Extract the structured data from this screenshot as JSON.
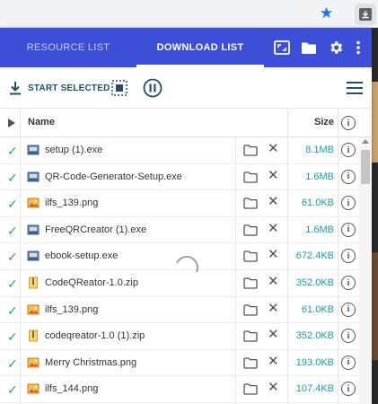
{
  "tabs": {
    "resource_list": "RESOURCE LIST",
    "download_list": "DOWNLOAD LIST"
  },
  "toolbar": {
    "start_selected": "START SELECTED"
  },
  "table": {
    "col_name": "Name",
    "col_size": "Size",
    "info_glyph": "i",
    "rows": [
      {
        "name": "setup (1).exe",
        "size": "8.1MB",
        "icon": "exe-icon"
      },
      {
        "name": "QR-Code-Generator-Setup.exe",
        "size": "1.6MB",
        "icon": "exe-icon"
      },
      {
        "name": "ilfs_139.png",
        "size": "61.0KB",
        "icon": "image-icon"
      },
      {
        "name": "FreeQRCreator (1).exe",
        "size": "1.6MB",
        "icon": "exe-icon"
      },
      {
        "name": "ebook-setup.exe",
        "size": "672.4KB",
        "icon": "exe-icon"
      },
      {
        "name": "CodeQReator-1.0.zip",
        "size": "352.0KB",
        "icon": "zip-icon"
      },
      {
        "name": "ilfs_139.png",
        "size": "61.0KB",
        "icon": "image-icon"
      },
      {
        "name": "codeqreator-1.0 (1).zip",
        "size": "352.0KB",
        "icon": "zip-icon"
      },
      {
        "name": "Merry Christmas.png",
        "size": "193.0KB",
        "icon": "image-icon"
      },
      {
        "name": "ilfs_144.png",
        "size": "107.4KB",
        "icon": "image-icon"
      }
    ]
  },
  "colors": {
    "header_bg": "#3d4fd6",
    "size_text": "#1a9ba8",
    "check": "#34a853"
  }
}
